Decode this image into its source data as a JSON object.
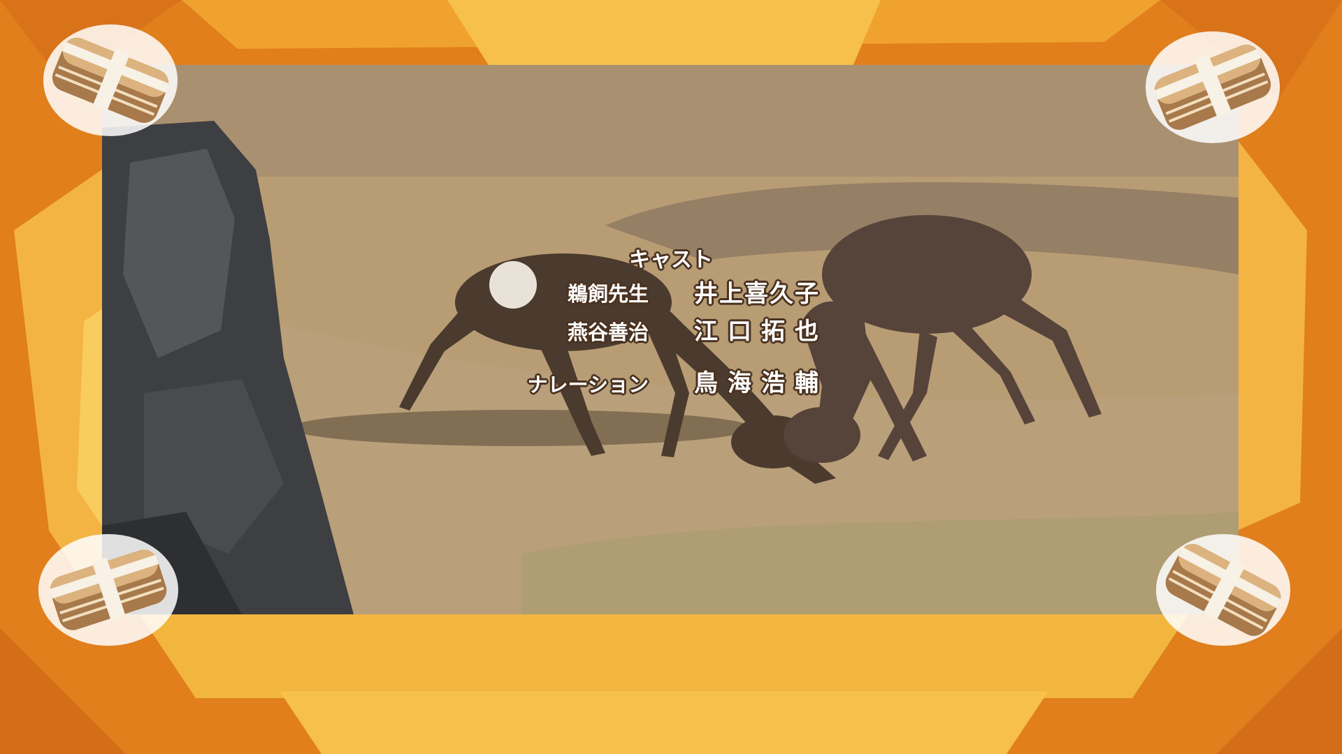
{
  "credits": {
    "heading": "キャスト",
    "rows": [
      {
        "role": "鵜飼先生",
        "name": "井上喜久子"
      },
      {
        "role": "燕谷善治",
        "name": "江口拓也"
      },
      {
        "role": "ナレーション",
        "name": "鳥海浩輔"
      }
    ]
  },
  "colors": {
    "frame_orange": "#e07f1c",
    "frame_yellow": "#f2b63e",
    "ground": "#b89c74",
    "deer": "#4b3a2e",
    "text_outline": "#4a3220"
  },
  "decorations": {
    "corner_item": "layered-cake-bundle-icon"
  }
}
